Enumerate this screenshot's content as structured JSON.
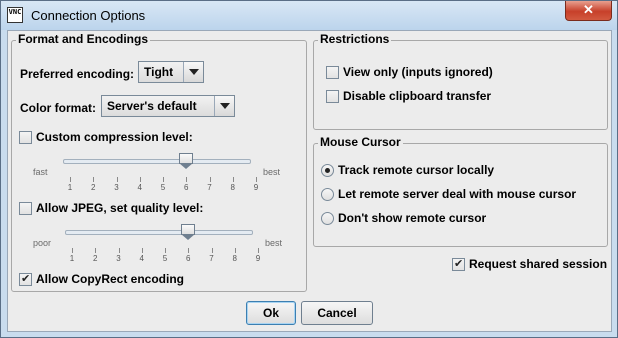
{
  "window": {
    "title": "Connection Options",
    "icon_text": "VNC",
    "close_glyph": "✕"
  },
  "format_group": {
    "title": "Format and Encodings",
    "preferred_encoding_label": "Preferred encoding:",
    "preferred_encoding_value": "Tight",
    "color_format_label": "Color format:",
    "color_format_value": "Server's default",
    "custom_compression_label": "Custom compression level:",
    "custom_compression_checked": false,
    "compression_slider": {
      "left_label": "fast",
      "right_label": "best",
      "ticks": [
        "1",
        "2",
        "3",
        "4",
        "5",
        "6",
        "7",
        "8",
        "9"
      ],
      "value": 6
    },
    "allow_jpeg_label": "Allow JPEG, set quality level:",
    "allow_jpeg_checked": false,
    "jpeg_slider": {
      "left_label": "poor",
      "right_label": "best",
      "ticks": [
        "1",
        "2",
        "3",
        "4",
        "5",
        "6",
        "7",
        "8",
        "9"
      ],
      "value": 6
    },
    "copyrect_label": "Allow CopyRect encoding",
    "copyrect_checked": true
  },
  "restrictions_group": {
    "title": "Restrictions",
    "view_only_label": "View only (inputs ignored)",
    "view_only_checked": false,
    "disable_clipboard_label": "Disable clipboard transfer",
    "disable_clipboard_checked": false
  },
  "mouse_group": {
    "title": "Mouse Cursor",
    "options": [
      {
        "label": "Track remote cursor locally",
        "selected": true
      },
      {
        "label": "Let remote server deal with mouse cursor",
        "selected": false
      },
      {
        "label": "Don't show remote cursor",
        "selected": false
      }
    ]
  },
  "shared_session": {
    "label": "Request shared session",
    "checked": true
  },
  "buttons": {
    "ok": "Ok",
    "cancel": "Cancel"
  }
}
